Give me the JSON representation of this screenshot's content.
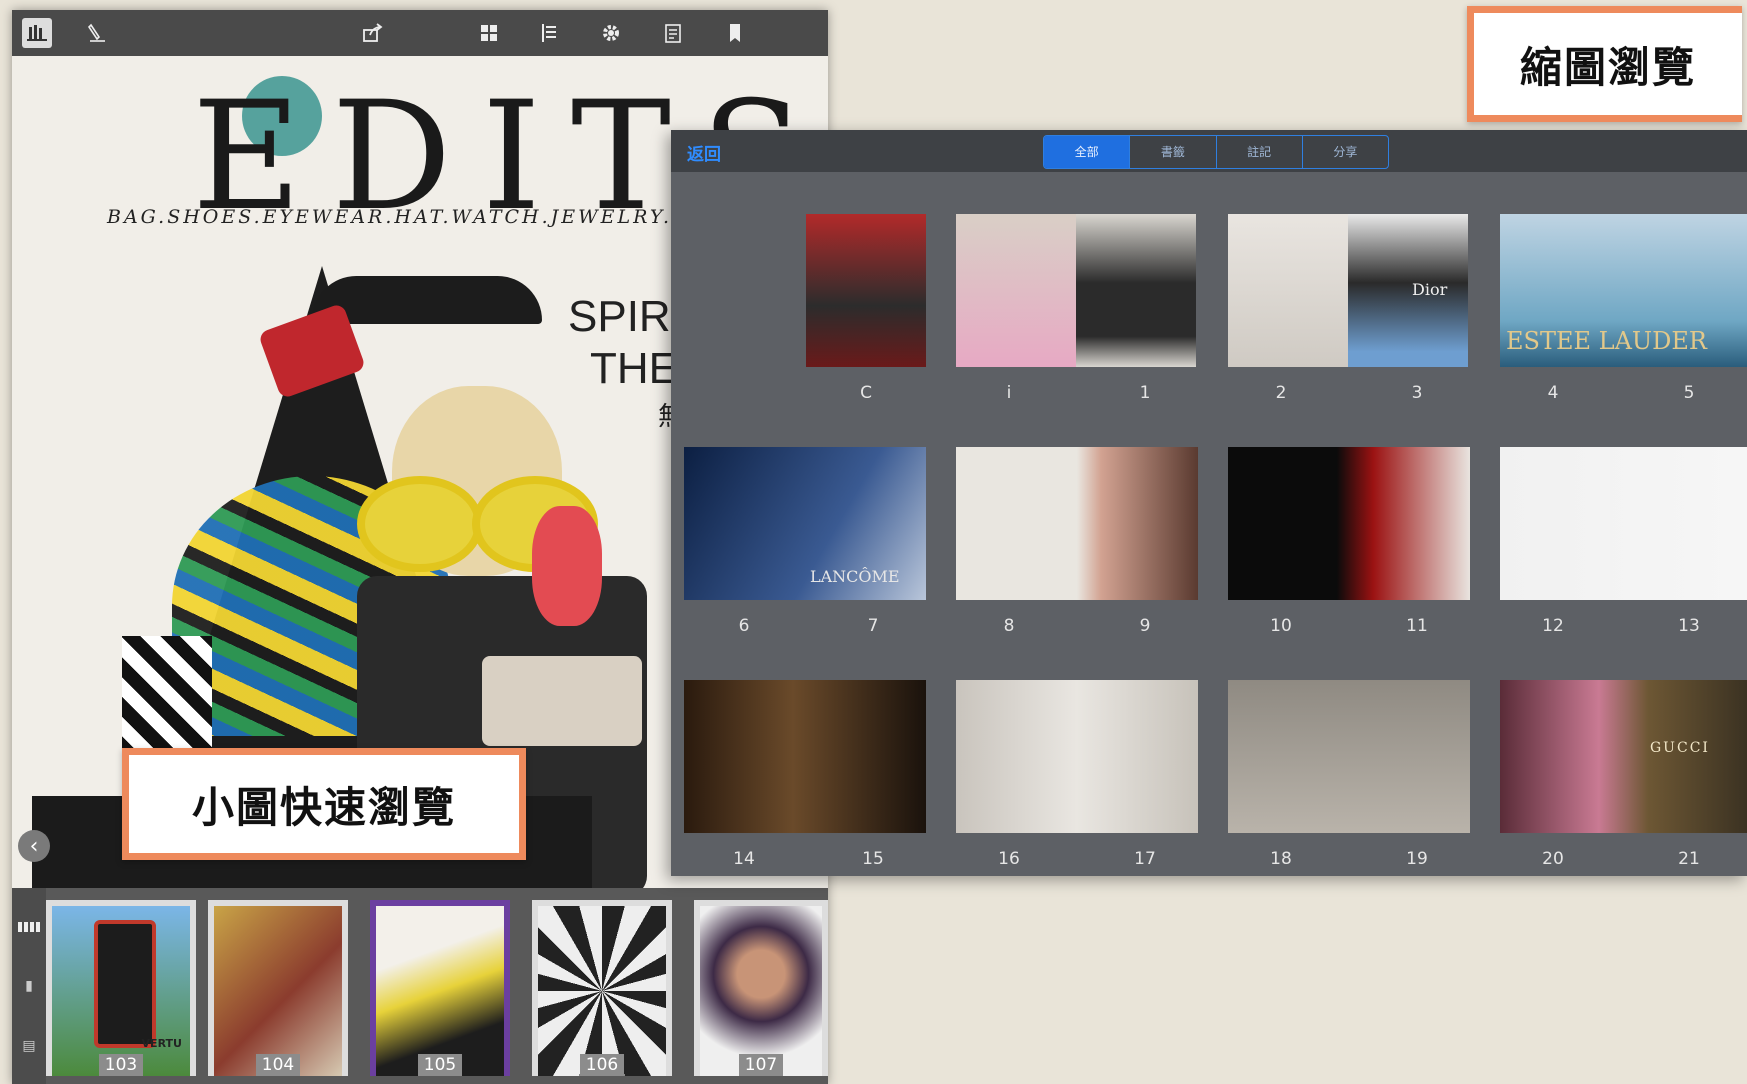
{
  "reader": {
    "toolbar": {
      "icons": [
        "library-icon",
        "pen-icon",
        "share-icon",
        "grid-icon",
        "list-icon",
        "gear-icon",
        "notes-icon",
        "bookmark-icon"
      ]
    },
    "page": {
      "logo": "EDITS",
      "tagline": "BAG.SHOES.EYEWEAR.HAT.WATCH.JEWELRY.MA",
      "headline_1": "SPIRIT",
      "headline_2": "THE",
      "headline_3": "無"
    },
    "thumb_strip": {
      "pages": [
        "103",
        "104",
        "105",
        "106",
        "107"
      ],
      "selected_index": 2,
      "brand_mark": "VERTU"
    }
  },
  "grid_panel": {
    "back_label": "返回",
    "tabs": [
      {
        "label": "全部",
        "active": true
      },
      {
        "label": "書籤",
        "active": false
      },
      {
        "label": "註記",
        "active": false
      },
      {
        "label": "分享",
        "active": false
      }
    ],
    "rows": [
      [
        "C",
        "i",
        "1",
        "2",
        "3",
        "4",
        "5"
      ],
      [
        "6",
        "7",
        "8",
        "9",
        "10",
        "11",
        "12",
        "13"
      ],
      [
        "14",
        "15",
        "16",
        "17",
        "18",
        "19",
        "20",
        "21"
      ]
    ],
    "brand_marks": {
      "estee": "ESTEE LAUDER",
      "lancome": "LANCÔME",
      "dior": "Dior",
      "gucci": "GUCCI"
    }
  },
  "callouts": {
    "small_preview": "小圖快速瀏覽",
    "thumbnail_view": "縮圖瀏覽"
  },
  "colors": {
    "accent_blue": "#2f8cff",
    "callout_border": "#ee8a5c"
  }
}
